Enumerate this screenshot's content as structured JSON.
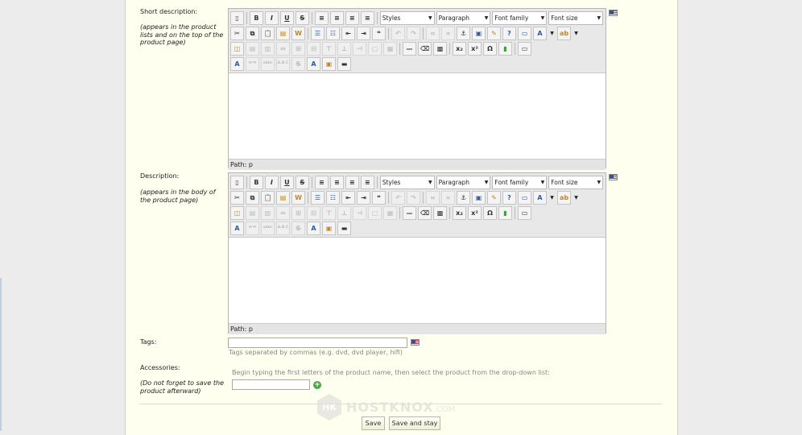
{
  "short_description": {
    "label": "Short description:",
    "note": "(appears in the product lists and on the top of the product page)",
    "path_label": "Path: p"
  },
  "description": {
    "label": "Description:",
    "note": "(appears in the body of the product page)",
    "path_label": "Path: p"
  },
  "toolbar": {
    "selects": [
      "Styles",
      "Paragraph",
      "Font family",
      "Font size"
    ],
    "row1_buttons": [
      {
        "icon": "new-document-icon",
        "glyph": "▯"
      },
      {
        "icon": "bold-icon",
        "glyph": "B"
      },
      {
        "icon": "italic-icon",
        "glyph": "I"
      },
      {
        "icon": "underline-icon",
        "glyph": "U"
      },
      {
        "icon": "strikethrough-icon",
        "glyph": "S"
      },
      {
        "icon": "align-left-icon",
        "glyph": "≡"
      },
      {
        "icon": "align-center-icon",
        "glyph": "≡"
      },
      {
        "icon": "align-right-icon",
        "glyph": "≡"
      },
      {
        "icon": "align-justify-icon",
        "glyph": "≡"
      }
    ],
    "row2_buttons": [
      {
        "icon": "cut-icon",
        "glyph": "✂"
      },
      {
        "icon": "copy-icon",
        "glyph": "⧉"
      },
      {
        "icon": "paste-icon",
        "glyph": "📋"
      },
      {
        "icon": "paste-text-icon",
        "glyph": "▤"
      },
      {
        "icon": "paste-word-icon",
        "glyph": "W"
      },
      {
        "icon": "bullet-list-icon",
        "glyph": "☰"
      },
      {
        "icon": "numbered-list-icon",
        "glyph": "☷"
      },
      {
        "icon": "outdent-icon",
        "glyph": "⇤"
      },
      {
        "icon": "indent-icon",
        "glyph": "⇥"
      },
      {
        "icon": "blockquote-icon",
        "glyph": "❝"
      },
      {
        "icon": "undo-icon",
        "glyph": "↶"
      },
      {
        "icon": "redo-icon",
        "glyph": "↷"
      },
      {
        "icon": "link-icon",
        "glyph": "∞"
      },
      {
        "icon": "unlink-icon",
        "glyph": "∝"
      },
      {
        "icon": "anchor-icon",
        "glyph": "⚓"
      },
      {
        "icon": "image-icon",
        "glyph": "▣"
      },
      {
        "icon": "cleanup-icon",
        "glyph": "✎"
      },
      {
        "icon": "help-icon",
        "glyph": "?"
      },
      {
        "icon": "code-icon",
        "glyph": "▭"
      },
      {
        "icon": "text-color-icon",
        "glyph": "A"
      },
      {
        "icon": "highlight-color-icon",
        "glyph": "ab"
      }
    ],
    "row3_buttons": [
      {
        "icon": "insert-date-icon",
        "glyph": "◫"
      },
      {
        "icon": "table-row-icon",
        "glyph": "▤"
      },
      {
        "icon": "table-col-icon",
        "glyph": "▥"
      },
      {
        "icon": "merge-cells-icon",
        "glyph": "⇔"
      },
      {
        "icon": "split-cells-icon",
        "glyph": "⊞"
      },
      {
        "icon": "delete-row-icon",
        "glyph": "⊟"
      },
      {
        "icon": "insert-layer-icon",
        "glyph": "⊤"
      },
      {
        "icon": "move-forward-icon",
        "glyph": "⊥"
      },
      {
        "icon": "absolute-icon",
        "glyph": "⊣"
      },
      {
        "icon": "style-icon",
        "glyph": "▢"
      },
      {
        "icon": "attribs-icon",
        "glyph": "▦"
      },
      {
        "icon": "horizontal-rule-icon",
        "glyph": "—"
      },
      {
        "icon": "remove-format-icon",
        "glyph": "⌫"
      },
      {
        "icon": "visual-aid-icon",
        "glyph": "▩"
      },
      {
        "icon": "subscript-icon",
        "glyph": "x₂"
      },
      {
        "icon": "superscript-icon",
        "glyph": "x²"
      },
      {
        "icon": "special-char-icon",
        "glyph": "Ω"
      },
      {
        "icon": "media-icon",
        "glyph": "▮"
      },
      {
        "icon": "fullscreen-icon",
        "glyph": "▭"
      }
    ],
    "row4_buttons": [
      {
        "icon": "spellcheck-icon",
        "glyph": "A"
      },
      {
        "icon": "cite-icon",
        "glyph": "“”"
      },
      {
        "icon": "abbr-icon",
        "glyph": "abbr"
      },
      {
        "icon": "acronym-icon",
        "glyph": "A.B.C"
      },
      {
        "icon": "del-icon",
        "glyph": "S"
      },
      {
        "icon": "ins-icon",
        "glyph": "A"
      },
      {
        "icon": "template-icon",
        "glyph": "▣"
      },
      {
        "icon": "pagebreak-icon",
        "glyph": "▬"
      }
    ]
  },
  "tags": {
    "label": "Tags:",
    "value": "",
    "hint": "Tags separated by commas (e.g. dvd, dvd player, hifi)"
  },
  "accessories": {
    "label": "Accessories:",
    "note": "(Do not forget to save the product afterward)",
    "hint": "Begin typing the first letters of the product name, then select the product from the drop-down list:",
    "value": ""
  },
  "actions": {
    "save_label": "Save",
    "save_stay_label": "Save and stay"
  },
  "watermark": {
    "logo": "HK",
    "text": "HOSTKNOX",
    "suffix": ".COM"
  }
}
